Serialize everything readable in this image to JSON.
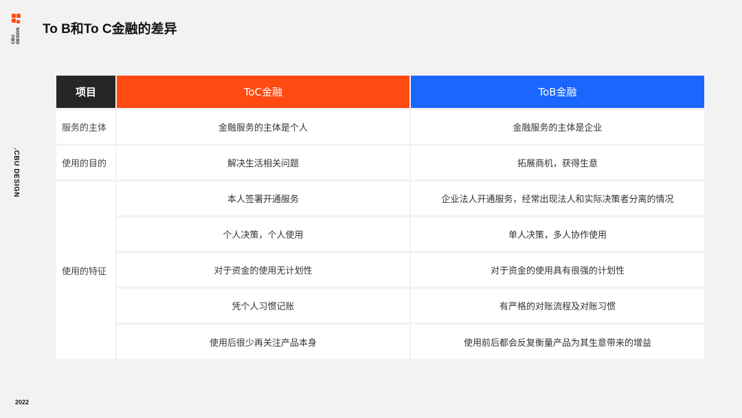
{
  "brand": {
    "logo_text_line1": "CBU",
    "logo_text_line2": "DESIGN",
    "side_label": ".CBU DESIGN",
    "year": "2022",
    "accent_color": "#ff4a12",
    "blue_color": "#1a66ff",
    "dark_color": "#262626"
  },
  "title": "To B和To C金融的差异",
  "table": {
    "headers": {
      "item": "项目",
      "toc": "ToC金融",
      "tob": "ToB金融"
    },
    "rows": [
      {
        "label": "服务的主体",
        "toc": "金融服务的主体是个人",
        "tob": "金融服务的主体是企业"
      },
      {
        "label": "使用的目的",
        "toc": "解决生活相关问题",
        "tob": "拓展商机，获得生意"
      }
    ],
    "group_label": "使用的特征",
    "group_rows": [
      {
        "toc": "本人签署开通服务",
        "tob": "企业法人开通服务，经常出现法人和实际决策者分离的情况"
      },
      {
        "toc": "个人决策，个人使用",
        "tob": "单人决策，多人协作使用"
      },
      {
        "toc": "对于资金的使用无计划性",
        "tob": "对于资金的使用具有很强的计划性"
      },
      {
        "toc": "凭个人习惯记账",
        "tob": "有严格的对账流程及对账习惯"
      },
      {
        "toc": "使用后很少再关注产品本身",
        "tob": "使用前后都会反复衡量产品为其生意带来的增益"
      }
    ]
  }
}
